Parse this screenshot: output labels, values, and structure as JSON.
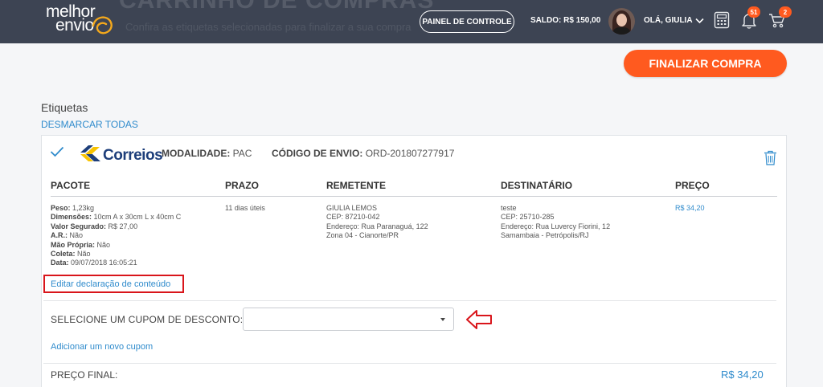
{
  "header": {
    "background_color": "#3d4453",
    "ghost_title": "CARRINHO DE COMPRAS",
    "ghost_subtitle": "Confira as etiquetas selecionadas para finalizar a sua compra",
    "logo_line1": "melhor",
    "logo_line2": "envio",
    "panel_button": "PAINEL DE CONTROLE",
    "saldo": "SALDO: R$ 150,00",
    "greeting": "OLÁ, GIULIA",
    "notifications_count": "51",
    "cart_count": "2",
    "icons": [
      "calculator-icon",
      "bell-icon",
      "cart-icon",
      "chevron-down-icon"
    ]
  },
  "actions": {
    "finalize_button": "FINALIZAR COMPRA",
    "accent_color": "#ff5a1f"
  },
  "section": {
    "title": "Etiquetas",
    "unselect_all": "DESMARCAR TODAS"
  },
  "label_card": {
    "carrier": "Correios",
    "modalidade_label": "MODALIDADE:",
    "modalidade_value": "PAC",
    "codigo_label": "CÓDIGO DE ENVIO:",
    "codigo_value": "ORD-201807277917",
    "headers": {
      "pacote": "PACOTE",
      "prazo": "PRAZO",
      "remetente": "REMETENTE",
      "destinatario": "DESTINATÁRIO",
      "preco": "PREÇO"
    },
    "pacote": [
      {
        "label": "Peso:",
        "value": "1,23kg"
      },
      {
        "label": "Dimensões:",
        "value": "10cm A x 30cm L x 40cm C"
      },
      {
        "label": "Valor Segurado:",
        "value": "R$ 27,00"
      },
      {
        "label": "A.R.:",
        "value": "Não"
      },
      {
        "label": "Mão Própria:",
        "value": "Não"
      },
      {
        "label": "Coleta:",
        "value": "Não"
      },
      {
        "label": "Data:",
        "value": "09/07/2018 16:05:21"
      }
    ],
    "prazo": "11 dias úteis",
    "remetente": [
      "GIULIA LEMOS",
      "CEP: 87210-042",
      "Endereço: Rua Paranaguá, 122",
      "Zona 04 - Cianorte/PR"
    ],
    "destinatario": [
      "teste",
      "CEP: 25710-285",
      "Endereço: Rua Luvercy Fiorini, 12",
      "Samambaia - Petrópolis/RJ"
    ],
    "preco": "R$ 34,20",
    "edit_declaration": "Editar declaração de conteúdo",
    "coupon_label": "SELECIONE UM CUPOM DE DESCONTO:",
    "coupon_value": "",
    "add_coupon": "Adicionar um novo cupom",
    "final_price_label": "PREÇO FINAL:",
    "final_price_value": "R$ 34,20",
    "link_color": "#2f8bcc",
    "highlight_color": "#d9151b"
  }
}
